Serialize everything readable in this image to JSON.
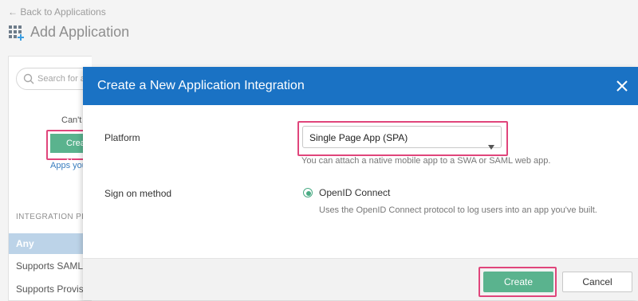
{
  "header": {
    "back_link": "← Back to Applications",
    "title": "Add Application"
  },
  "sidebar": {
    "search_placeholder": "Search for an application",
    "cant_find_text": "Can't find an app?",
    "create_button_label": "Create New App",
    "apps_you_text": "Apps you created",
    "integration_label": "INTEGRATION PROPERTIES",
    "filters": [
      "Any",
      "Supports SAML",
      "Supports Provisioning"
    ]
  },
  "modal": {
    "title": "Create a New Application Integration",
    "platform_label": "Platform",
    "platform_value": "Single Page App (SPA)",
    "platform_hint": "You can attach a native mobile app to a SWA or SAML web app.",
    "sign_on_label": "Sign on method",
    "sign_on_option": "OpenID Connect",
    "sign_on_desc": "Uses the OpenID Connect protocol to log users into an app you've built.",
    "create_label": "Create",
    "cancel_label": "Cancel"
  },
  "colors": {
    "header_blue": "#1a72c4",
    "accent_green": "#5ab38e",
    "highlight_pink": "#e0457b"
  }
}
